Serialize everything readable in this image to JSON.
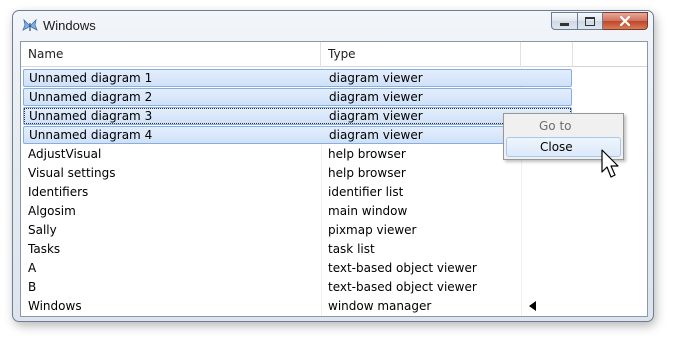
{
  "window": {
    "title": "Windows",
    "app_icon": "butterfly-icon"
  },
  "caption_buttons": {
    "minimize": "minimize-icon",
    "maximize": "maximize-icon",
    "close": "close-icon"
  },
  "columns": {
    "name": "Name",
    "type": "Type"
  },
  "rows": [
    {
      "name": "Unnamed diagram 1",
      "type": "diagram viewer",
      "selected": true
    },
    {
      "name": "Unnamed diagram 2",
      "type": "diagram viewer",
      "selected": true
    },
    {
      "name": "Unnamed diagram 3",
      "type": "diagram viewer",
      "selected": true,
      "focused": true
    },
    {
      "name": "Unnamed diagram 4",
      "type": "diagram viewer",
      "selected": true
    },
    {
      "name": "AdjustVisual",
      "type": "help browser"
    },
    {
      "name": "Visual settings",
      "type": "help browser"
    },
    {
      "name": "Identifiers",
      "type": "identifier list"
    },
    {
      "name": "Algosim",
      "type": "main window"
    },
    {
      "name": "Sally",
      "type": "pixmap viewer"
    },
    {
      "name": "Tasks",
      "type": "task list"
    },
    {
      "name": "A",
      "type": "text-based object viewer"
    },
    {
      "name": "B",
      "type": "text-based object viewer"
    },
    {
      "name": "Windows",
      "type": "window manager",
      "current": true
    }
  ],
  "context_menu": {
    "items": [
      {
        "label": "Go to",
        "enabled": false
      },
      {
        "label": "Close",
        "enabled": true,
        "hot": true
      }
    ]
  },
  "colors": {
    "selection": "#cfe1f8",
    "selection_border": "#87aee0",
    "close_button": "#c0462a"
  }
}
